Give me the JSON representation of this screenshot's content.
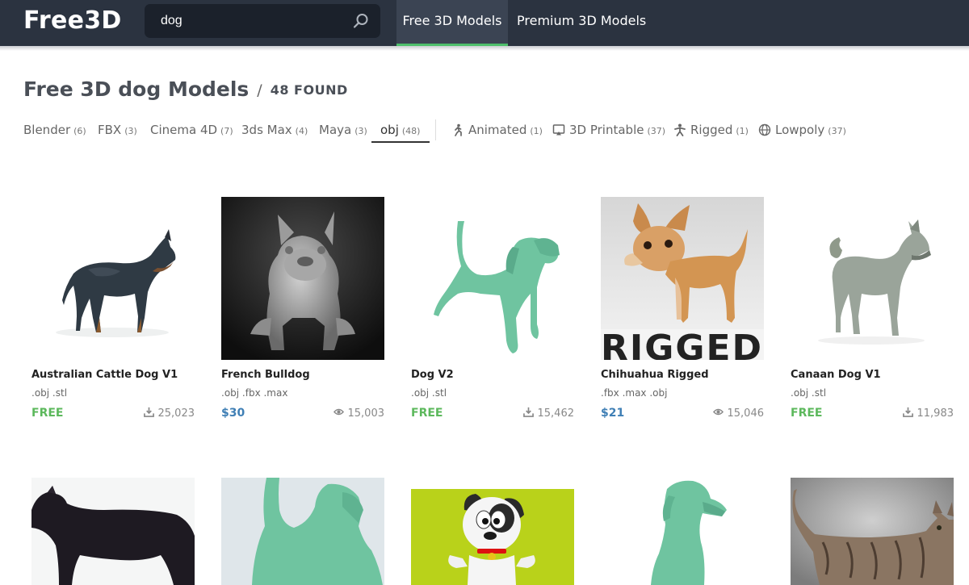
{
  "header": {
    "logo": "Free3D",
    "search_value": "dog",
    "nav": [
      {
        "label": "Free 3D Models",
        "active": true
      },
      {
        "label": "Premium 3D Models",
        "active": false
      }
    ],
    "accent_color": "#4dbf6b"
  },
  "title": {
    "text": "Free 3D dog Models",
    "separator": "/",
    "found": "48 FOUND"
  },
  "filters": [
    {
      "label": "Blender",
      "count": "(6)",
      "icon": null,
      "active": false
    },
    {
      "label": "FBX",
      "count": "(3)",
      "icon": null,
      "active": false
    },
    {
      "label": "Cinema 4D",
      "count": "(7)",
      "icon": null,
      "active": false
    },
    {
      "label": "3ds Max",
      "count": "(4)",
      "icon": null,
      "active": false
    },
    {
      "label": "Maya",
      "count": "(3)",
      "icon": null,
      "active": false
    },
    {
      "label": "obj",
      "count": "(48)",
      "icon": null,
      "active": true
    },
    {
      "label": "Animated",
      "count": "(1)",
      "icon": "running-person-icon",
      "active": false
    },
    {
      "label": "3D Printable",
      "count": "(37)",
      "icon": "printer-icon",
      "active": false
    },
    {
      "label": "Rigged",
      "count": "(1)",
      "icon": "rigged-figure-icon",
      "active": false
    },
    {
      "label": "Lowpoly",
      "count": "(37)",
      "icon": "globe-icon",
      "active": false
    }
  ],
  "models": [
    {
      "title": "Australian Cattle Dog V1",
      "formats": ".obj .stl",
      "price": "FREE",
      "stat_icon": "download-icon",
      "stat": "25,023"
    },
    {
      "title": "French Bulldog",
      "formats": ".obj .fbx .max",
      "price": "$30",
      "stat_icon": "eye-icon",
      "stat": "15,003"
    },
    {
      "title": "Dog V2",
      "formats": ".obj .stl",
      "price": "FREE",
      "stat_icon": "download-icon",
      "stat": "15,462"
    },
    {
      "title": "Chihuahua Rigged",
      "formats": ".fbx .max .obj",
      "price": "$21",
      "stat_icon": "eye-icon",
      "stat": "15,046",
      "thumb_text": "RIGGED"
    },
    {
      "title": "Canaan Dog V1",
      "formats": ".obj .stl",
      "price": "FREE",
      "stat_icon": "download-icon",
      "stat": "11,983"
    }
  ],
  "colors": {
    "free_price": "#5cb85c",
    "paid_price": "#3f7fb5",
    "header_bg": "#2b3340"
  }
}
